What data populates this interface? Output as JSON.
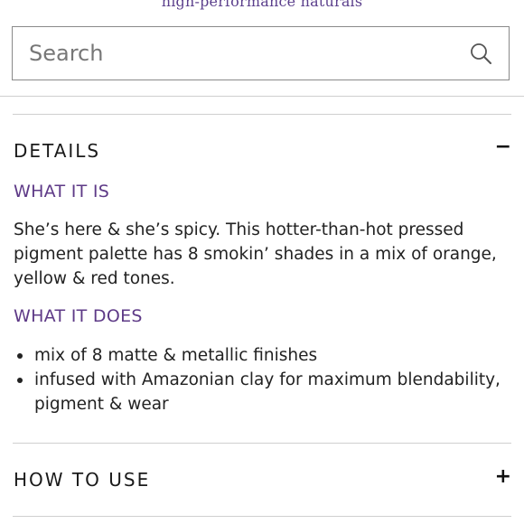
{
  "brand": {
    "tagline": "high-performance naturals"
  },
  "search": {
    "placeholder": "Search"
  },
  "details": {
    "title": "DETAILS",
    "toggle": "−",
    "what_it_is": {
      "heading": "WHAT IT IS",
      "text": "She’s here & she’s spicy. This hotter-than-hot pressed pigment palette has 8 smokin’ shades in a mix of orange, yellow & red tones."
    },
    "what_it_does": {
      "heading": "WHAT IT DOES",
      "bullets": [
        "mix of 8 matte & metallic finishes",
        "infused with Amazonian clay for maximum blendability, pigment & wear"
      ]
    }
  },
  "how_to_use": {
    "title": "HOW TO USE",
    "toggle": "+"
  },
  "icons": {
    "search": "search-icon",
    "collapse": "minus-icon",
    "expand": "plus-icon"
  },
  "colors": {
    "accent": "#5e3a87",
    "text": "#222222",
    "divider": "#cfcfcf"
  }
}
